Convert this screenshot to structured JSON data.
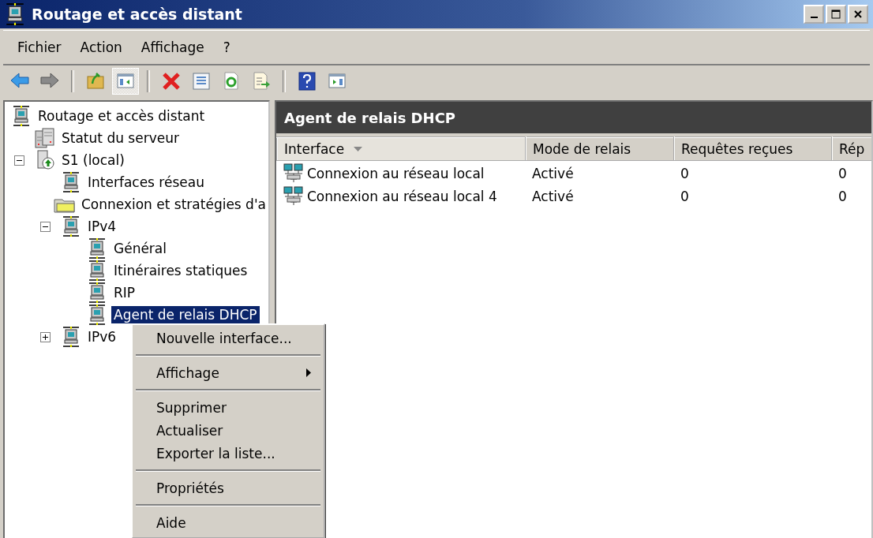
{
  "window": {
    "title": "Routage et accès distant"
  },
  "menu_bar": [
    "Fichier",
    "Action",
    "Affichage",
    "?"
  ],
  "toolbar": [
    {
      "kind": "back",
      "pressed": false
    },
    {
      "kind": "forward",
      "pressed": false
    },
    {
      "kind": "separator"
    },
    {
      "kind": "up-folder",
      "pressed": false
    },
    {
      "kind": "console-tree",
      "pressed": true
    },
    {
      "kind": "separator"
    },
    {
      "kind": "delete",
      "pressed": false
    },
    {
      "kind": "properties",
      "pressed": false
    },
    {
      "kind": "refresh",
      "pressed": false
    },
    {
      "kind": "export",
      "pressed": false
    },
    {
      "kind": "separator"
    },
    {
      "kind": "help",
      "pressed": false
    },
    {
      "kind": "action-pane",
      "pressed": false
    }
  ],
  "tree": [
    {
      "label": "Routage et accès distant",
      "kind": "network",
      "selected": false,
      "children": [
        {
          "label": "Statut du serveur",
          "kind": "server",
          "selected": false
        },
        {
          "label": "S1 (local)",
          "kind": "local-server",
          "selected": false,
          "expanded": true,
          "children": [
            {
              "label": "Interfaces réseau",
              "kind": "network",
              "selected": false
            },
            {
              "label": "Connexion et stratégies d'a",
              "kind": "folder",
              "selected": false
            },
            {
              "label": "IPv4",
              "kind": "network",
              "selected": false,
              "expanded": true,
              "children": [
                {
                  "label": "Général",
                  "kind": "network",
                  "selected": false
                },
                {
                  "label": "Itinéraires statiques",
                  "kind": "network",
                  "selected": false
                },
                {
                  "label": "RIP",
                  "kind": "network",
                  "selected": false
                },
                {
                  "label": "Agent de relais DHCP",
                  "kind": "network",
                  "selected": true
                }
              ]
            },
            {
              "label": "IPv6",
              "kind": "network",
              "selected": false,
              "expanded": false
            }
          ]
        }
      ]
    }
  ],
  "details": {
    "title": "Agent de relais DHCP",
    "columns": [
      {
        "label": "Interface",
        "sorted": true
      },
      {
        "label": "Mode de relais",
        "sorted": false
      },
      {
        "label": "Requêtes reçues",
        "sorted": false
      },
      {
        "label": "Rép",
        "sorted": false
      }
    ],
    "rows": [
      [
        "Connexion au réseau local",
        "Activé",
        "0",
        "0"
      ],
      [
        "Connexion au réseau local 4",
        "Activé",
        "0",
        "0"
      ]
    ]
  },
  "context_menu": [
    {
      "kind": "item",
      "label": "Nouvelle interface...",
      "submenu": false
    },
    {
      "kind": "separator"
    },
    {
      "kind": "item",
      "label": "Affichage",
      "submenu": true
    },
    {
      "kind": "separator"
    },
    {
      "kind": "item",
      "label": "Supprimer",
      "submenu": false
    },
    {
      "kind": "item",
      "label": "Actualiser",
      "submenu": false
    },
    {
      "kind": "item",
      "label": "Exporter la liste...",
      "submenu": false
    },
    {
      "kind": "separator"
    },
    {
      "kind": "item",
      "label": "Propriétés",
      "submenu": false
    },
    {
      "kind": "separator"
    },
    {
      "kind": "item",
      "label": "Aide",
      "submenu": false
    }
  ]
}
